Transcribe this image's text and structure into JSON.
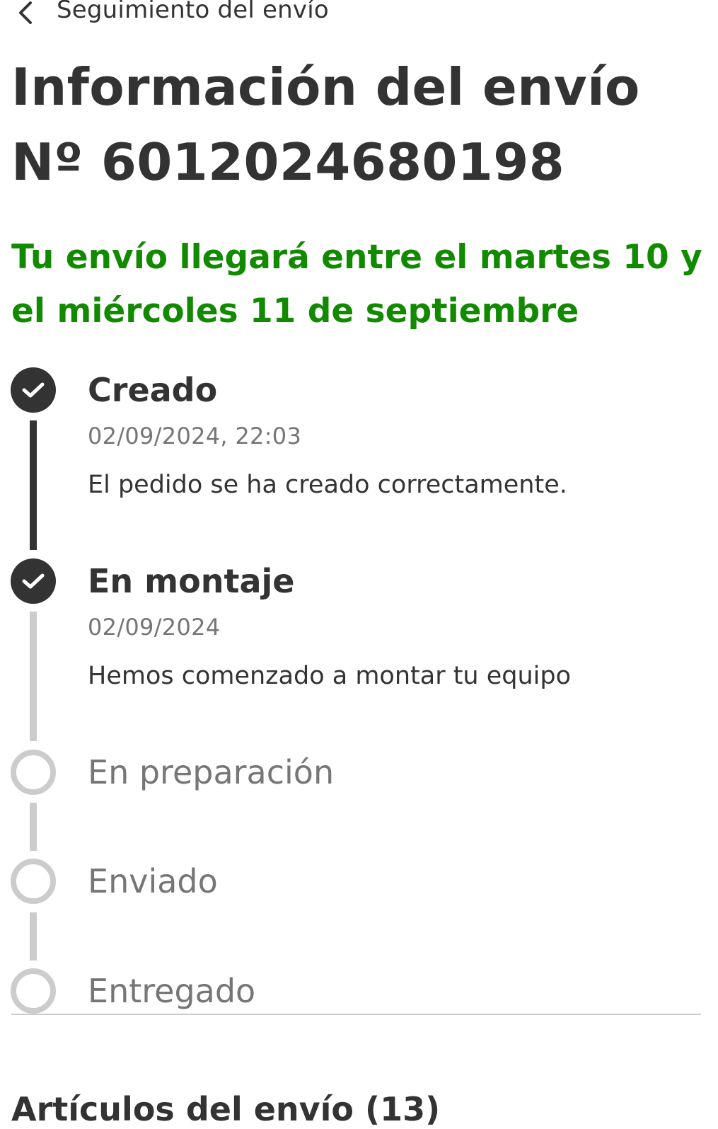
{
  "header": {
    "back_icon": "chevron-left-icon",
    "title": "Seguimiento del envío"
  },
  "shipment": {
    "heading": "Información del envío Nº 6012024680198",
    "eta": "Tu envío llegará entre el martes 10 y el miércoles 11 de septiembre",
    "eta_color": "#118a00"
  },
  "timeline": {
    "steps": [
      {
        "status": "done",
        "title": "Creado",
        "date": "02/09/2024, 22:03",
        "description": "El pedido se ha creado correctamente.",
        "icon": "check-icon"
      },
      {
        "status": "done",
        "title": "En montaje",
        "date": "02/09/2024",
        "description": "Hemos comenzado a montar tu equipo",
        "icon": "check-icon"
      },
      {
        "status": "pending",
        "title": "En preparación"
      },
      {
        "status": "pending",
        "title": "Enviado"
      },
      {
        "status": "pending",
        "title": "Entregado"
      }
    ]
  },
  "items_section": {
    "title": "Artículos del envío (13)"
  },
  "colors": {
    "text": "#333333",
    "muted": "#767676",
    "inactive": "#cccccc",
    "accent_green": "#118a00"
  }
}
